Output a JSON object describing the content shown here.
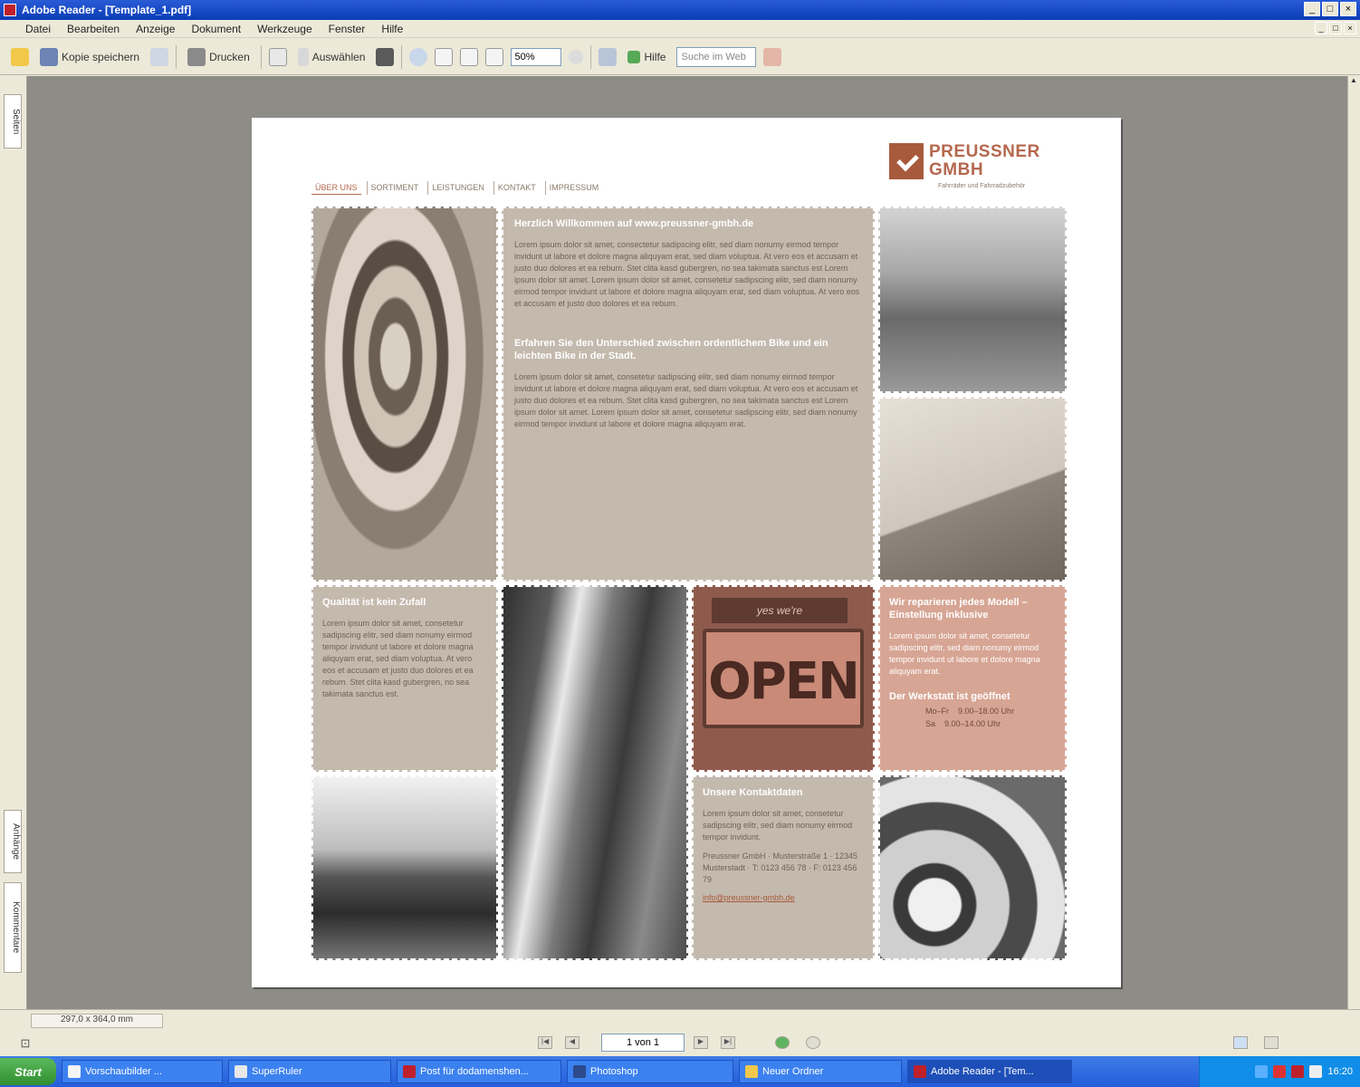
{
  "window": {
    "title": "Adobe Reader - [Template_1.pdf]",
    "controls": [
      "_",
      "□",
      "×"
    ],
    "doc_controls": [
      "_",
      "□",
      "×"
    ]
  },
  "menu": [
    "Datei",
    "Bearbeiten",
    "Anzeige",
    "Dokument",
    "Werkzeuge",
    "Fenster",
    "Hilfe"
  ],
  "toolbar": {
    "save_label": "Kopie speichern",
    "print_label": "Drucken",
    "select_label": "Auswählen",
    "zoom_value": "50%",
    "help_label": "Hilfe",
    "search_placeholder": "Suche im Web"
  },
  "left_tabs": [
    "Seiten",
    "Anhänge",
    "Kommentare"
  ],
  "page": {
    "nav": [
      "ÜBER UNS",
      "SORTIMENT",
      "LEISTUNGEN",
      "KONTAKT",
      "IMPRESSUM"
    ],
    "logo_line1": "PREUSSNER",
    "logo_line2": "GMBH",
    "logo_tagline": "Fahrräder und Fahrradzubehör",
    "main_heading": "Herzlich Willkommen auf www.preussner-gmbh.de",
    "main_text": "Lorem ipsum dolor sit amet, consectetur sadipscing elitr, sed diam nonumy eirmod tempor invidunt ut labore et dolore magna aliquyam erat, sed diam voluptua. At vero eos et accusam et justo duo dolores et ea rebum. Stet clita kasd gubergren, no sea takimata sanctus est Lorem ipsum dolor sit amet. Lorem ipsum dolor sit amet, consetetur sadipscing elitr, sed diam nonumy eirmod tempor invidunt ut labore et dolore magna aliquyam erat, sed diam voluptua. At vero eos et accusam et justo duo dolores et ea rebum.",
    "second_heading": "Erfahren Sie den Unterschied zwischen ordentlichem Bike und ein leichten Bike in der Stadt.",
    "second_text": "Lorem ipsum dolor sit amet, consetetur sadipscing elitr, sed diam nonumy eirmod tempor invidunt ut labore et dolore magna aliquyam erat, sed diam voluptua. At vero eos et accusam et justo duo dolores et ea rebum. Stet clita kasd gubergren, no sea takimata sanctus est Lorem ipsum dolor sit amet. Lorem ipsum dolor sit amet, consetetur sadipscing elitr, sed diam nonumy eirmod tempor invidunt ut labore et dolore magna aliquyam erat.",
    "left_heading": "Qualität ist kein Zufall",
    "left_text": "Lorem ipsum dolor sit amet, consetetur sadipscing elitr, sed diam nonumy eirmod tempor invidunt ut labore et dolore magna aliquyam erat, sed diam voluptua. At vero eos et accusam et justo duo dolores et ea rebum. Stet clita kasd gubergren, no sea takimata sanctus est.",
    "open_sign_top": "yes we're",
    "open_sign": "OPEN",
    "salmon_heading": "Wir reparieren jedes Modell – Einstellung inklusive",
    "salmon_text": "Lorem ipsum dolor sit amet, consetetur sadipscing elitr, sed diam nonumy eirmod tempor invidunt ut labore et dolore magna aliquyam erat.",
    "salmon_heading2": "Der Werkstatt ist geöffnet",
    "hours": [
      {
        "day": "Mo–Fr",
        "time": "9.00–18.00 Uhr"
      },
      {
        "day": "Sa",
        "time": "9.00–14.00 Uhr"
      }
    ],
    "contact_heading": "Unsere Kontaktdaten",
    "contact_text": "Lorem ipsum dolor sit amet, consetetur sadipscing elitr, sed diam nonumy eirmod tempor invidunt.",
    "contact_address": "Preussner GmbH · Musterstraße 1 · 12345 Musterstadt · T: 0123 456 78 · F: 0123 456 79",
    "contact_link": "info@preussner-gmbh.de"
  },
  "status": {
    "page_size": "297,0 x 364,0 mm",
    "page_indicator": "1 von 1"
  },
  "taskbar": {
    "start": "Start",
    "tasks": [
      {
        "label": "Vorschaubilder ..."
      },
      {
        "label": "SuperRuler"
      },
      {
        "label": "Post für dodamenshen..."
      },
      {
        "label": "Photoshop"
      },
      {
        "label": "Neuer Ordner"
      },
      {
        "label": "Adobe Reader - [Tem..."
      }
    ],
    "clock": "16:20"
  }
}
